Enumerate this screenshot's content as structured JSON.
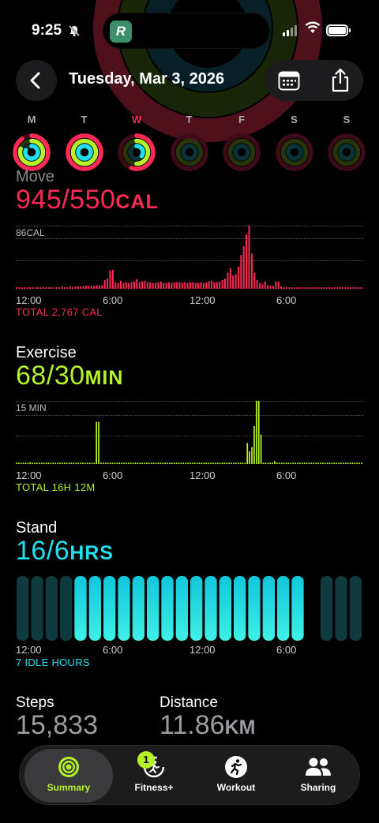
{
  "status_bar": {
    "time": "9:25"
  },
  "header": {
    "date": "Tuesday, Mar 3, 2026"
  },
  "week": {
    "days": [
      "M",
      "T",
      "W",
      "T",
      "F",
      "S",
      "S"
    ],
    "today_index": 1,
    "selected_index": 2
  },
  "move": {
    "label": "Move",
    "value": "945/550",
    "unit": "CAL",
    "chart_max_label": "86CAL",
    "ticks": [
      "12:00",
      "6:00",
      "12:00",
      "6:00"
    ],
    "total": "TOTAL 2,767 CAL",
    "color": "#ff2a55"
  },
  "exercise": {
    "label": "Exercise",
    "value": "68/30",
    "unit": "MIN",
    "chart_max_label": "15 MIN",
    "ticks": [
      "12:00",
      "6:00",
      "12:00",
      "6:00"
    ],
    "total": "TOTAL 16H 12M",
    "color": "#b5f227"
  },
  "stand": {
    "label": "Stand",
    "value": "16/6",
    "unit": "HRS",
    "ticks": [
      "12:00",
      "6:00",
      "12:00",
      "6:00"
    ],
    "total": "7 IDLE HOURS",
    "color": "#1fe0f0"
  },
  "stats": {
    "steps_label": "Steps",
    "steps_value": "15,833",
    "distance_label": "Distance",
    "distance_value": "11.86",
    "distance_unit": "KM"
  },
  "tabbar": {
    "tabs": [
      "Summary",
      "Fitness+",
      "Workout",
      "Sharing"
    ],
    "active": "Summary",
    "fitness_badge": "1"
  },
  "chart_data": [
    {
      "type": "bar",
      "title": "Move",
      "ylabel": "86CAL",
      "ylim": [
        0,
        86
      ],
      "x_ticks": [
        "12:00",
        "6:00",
        "12:00",
        "6:00"
      ],
      "values": [
        2,
        2,
        2,
        2,
        2,
        2,
        2,
        2,
        2,
        2,
        2,
        2,
        2,
        2,
        2,
        2,
        2,
        3,
        2,
        2,
        3,
        2,
        3,
        3,
        3,
        4,
        4,
        4,
        4,
        4,
        5,
        5,
        5,
        12,
        14,
        25,
        26,
        9,
        8,
        11,
        8,
        9,
        8,
        9,
        10,
        13,
        9,
        10,
        11,
        9,
        9,
        8,
        8,
        9,
        10,
        8,
        8,
        9,
        8,
        9,
        9,
        9,
        8,
        9,
        8,
        9,
        9,
        8,
        8,
        9,
        8,
        9,
        10,
        11,
        9,
        9,
        10,
        12,
        14,
        22,
        28,
        18,
        20,
        30,
        46,
        58,
        74,
        86,
        48,
        22,
        12,
        8,
        6,
        10,
        5,
        4,
        4,
        10,
        10,
        3,
        2,
        2,
        2,
        2,
        2,
        2,
        2,
        2,
        2,
        2,
        2,
        2,
        2,
        2,
        2,
        2,
        2,
        2,
        2,
        2,
        2,
        2,
        2,
        2,
        2,
        2,
        2,
        2,
        2,
        2
      ]
    },
    {
      "type": "bar",
      "title": "Exercise",
      "ylabel": "15 MIN",
      "ylim": [
        0,
        15
      ],
      "x_ticks": [
        "12:00",
        "6:00",
        "12:00",
        "6:00"
      ],
      "values": [
        0.3,
        0.3,
        0.3,
        0.3,
        0.3,
        0.3,
        0.4,
        0.3,
        0.3,
        0.3,
        0.3,
        0.3,
        0.3,
        0.3,
        0.3,
        0.3,
        0.3,
        0.3,
        0.3,
        0.3,
        0.3,
        0.3,
        0.3,
        0.3,
        0.3,
        0.3,
        0.3,
        0.3,
        0.3,
        0.3,
        0.3,
        0.3,
        0.3,
        0.3,
        0.3,
        10,
        10,
        0.3,
        0.3,
        0.3,
        0.3,
        0.3,
        0.3,
        0.3,
        0.3,
        0.3,
        0.3,
        0.3,
        0.3,
        0.3,
        0.3,
        0.3,
        0.3,
        0.3,
        0.3,
        0.3,
        0.3,
        0.3,
        0.3,
        0.3,
        0.3,
        0.3,
        0.3,
        0.3,
        0.3,
        0.3,
        0.3,
        0.3,
        0.3,
        0.3,
        0.3,
        0.3,
        0.3,
        0.3,
        0.3,
        0.3,
        0.3,
        0.3,
        0.3,
        0.3,
        0.3,
        0.3,
        0.3,
        0.3,
        0.3,
        0.3,
        0.3,
        0.3,
        0.3,
        0.3,
        0.3,
        0.3,
        0.3,
        0.3,
        0.3,
        0.3,
        0.3,
        0.3,
        0.3,
        0.3,
        0.3,
        5,
        3,
        4,
        9,
        15,
        15,
        7,
        0.3,
        0.3,
        0.3,
        0.3,
        0.3,
        0.7,
        0.3,
        0.3,
        0.3,
        0.3,
        0.3,
        0.3,
        0.3,
        0.3,
        0.3,
        0.3,
        0.3,
        0.3,
        0.3,
        0.3,
        0.3,
        0.3,
        0.3,
        0.3,
        0.3,
        0.3,
        0.3,
        0.3,
        0.3,
        0.3,
        0.3,
        0.3,
        0.3,
        0.3,
        0.3,
        0.3,
        0.3,
        0.3,
        0.3,
        0.3,
        0.3,
        0.3,
        0.3,
        0.3
      ]
    },
    {
      "type": "bar",
      "title": "Stand",
      "x_ticks": [
        "12:00",
        "6:00",
        "12:00",
        "6:00"
      ],
      "values": [
        0,
        0,
        0,
        0,
        1,
        1,
        1,
        1,
        1,
        1,
        1,
        1,
        1,
        1,
        1,
        1,
        1,
        1,
        1,
        1,
        null,
        0,
        0,
        0
      ]
    }
  ]
}
